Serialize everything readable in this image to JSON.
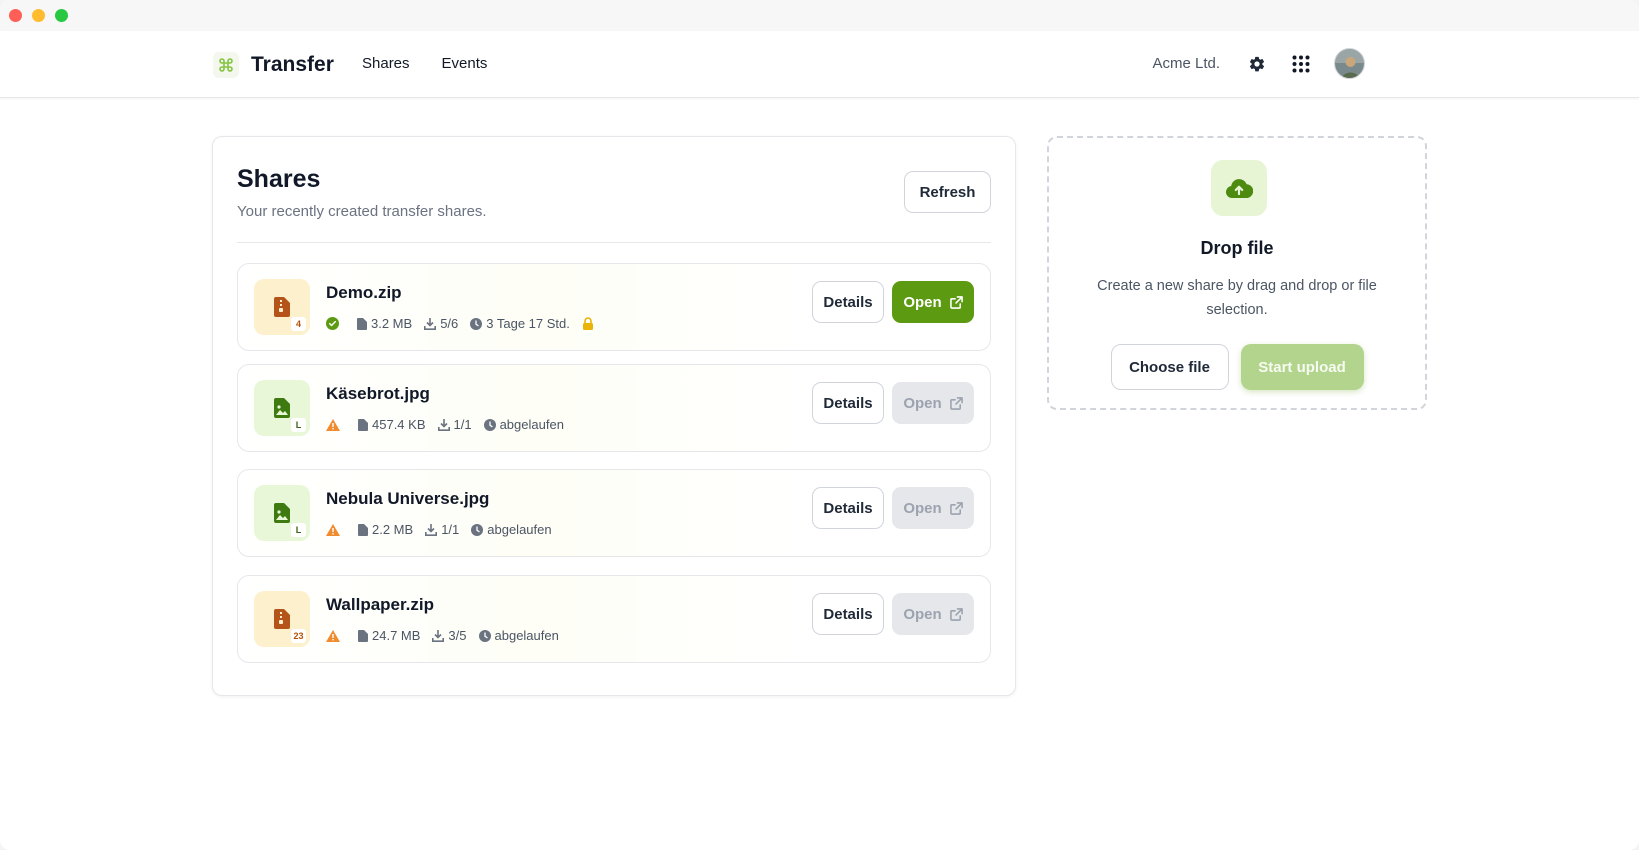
{
  "app": {
    "name": "Transfer",
    "logo_icon": "command-icon",
    "accent_color": "#5c9a11"
  },
  "nav": {
    "items": [
      {
        "label": "Shares"
      },
      {
        "label": "Events"
      }
    ]
  },
  "header": {
    "organization": "Acme Ltd.",
    "icons": [
      "gear-icon",
      "grid-icon",
      "avatar"
    ]
  },
  "shares": {
    "title": "Shares",
    "subtitle": "Your recently created transfer shares.",
    "refresh_label": "Refresh",
    "details_label": "Details",
    "open_label": "Open",
    "items": [
      {
        "name": "Demo.zip",
        "type": "zip",
        "badge": "4",
        "status": "ok",
        "size": "3.2 MB",
        "downloads": "5/6",
        "expiry": "3 Tage 17 Std.",
        "locked": true,
        "open_enabled": true
      },
      {
        "name": "Käsebrot.jpg",
        "type": "image",
        "badge": "L",
        "status": "warning",
        "size": "457.4 KB",
        "downloads": "1/1",
        "expiry": "abgelaufen",
        "locked": false,
        "open_enabled": false
      },
      {
        "name": "Nebula Universe.jpg",
        "type": "image",
        "badge": "L",
        "status": "warning",
        "size": "2.2 MB",
        "downloads": "1/1",
        "expiry": "abgelaufen",
        "locked": false,
        "open_enabled": false
      },
      {
        "name": "Wallpaper.zip",
        "type": "zip",
        "badge": "23",
        "status": "warning",
        "size": "24.7 MB",
        "downloads": "3/5",
        "expiry": "abgelaufen",
        "locked": false,
        "open_enabled": false
      }
    ]
  },
  "dropzone": {
    "icon": "cloud-upload-icon",
    "title": "Drop file",
    "description": "Create a new share by drag and drop or file selection.",
    "choose_label": "Choose file",
    "upload_label": "Start upload"
  }
}
